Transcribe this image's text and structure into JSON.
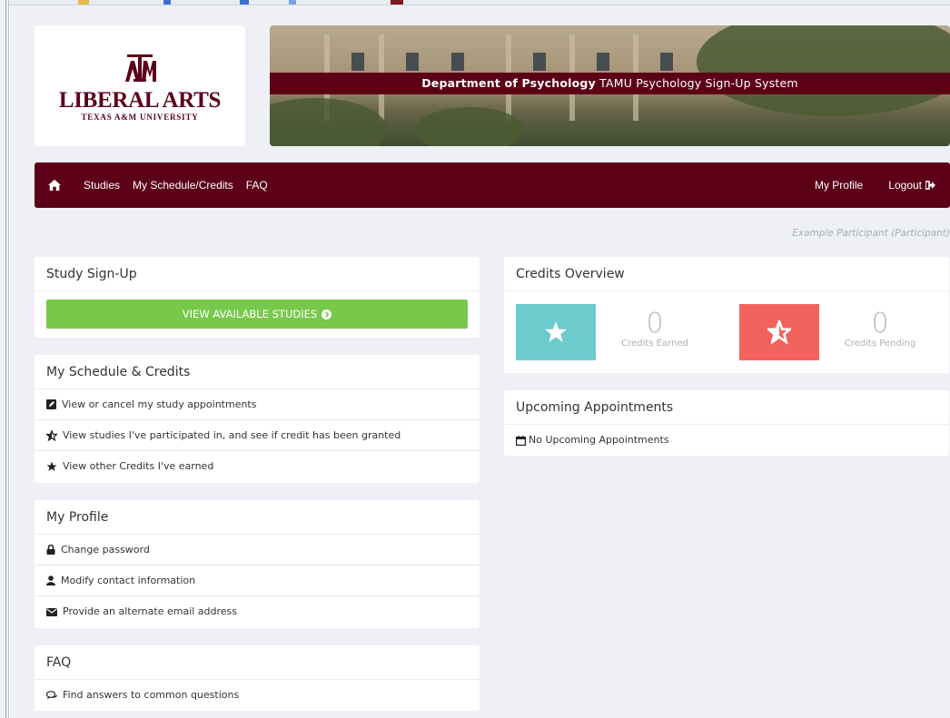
{
  "header": {
    "logo_text": "LIBERAL ARTS",
    "logo_sub": "TEXAS A&M UNIVERSITY",
    "banner_bold": "Department of Psychology",
    "banner_text": " TAMU Psychology Sign-Up System"
  },
  "nav": {
    "items": [
      "Studies",
      "My Schedule/Credits",
      "FAQ"
    ],
    "profile": "My Profile",
    "logout": "Logout"
  },
  "user": "Example Participant (Participant)",
  "study_signup": {
    "title": "Study Sign-Up",
    "button": "VIEW AVAILABLE STUDIES"
  },
  "schedule": {
    "title": "My Schedule & Credits",
    "items": [
      {
        "icon": "edit-icon",
        "label": "View or cancel my study appointments"
      },
      {
        "icon": "half-star-icon",
        "label": "View studies I've participated in, and see if credit has been granted"
      },
      {
        "icon": "star-icon",
        "label": "View other Credits I've earned"
      }
    ]
  },
  "profile": {
    "title": "My Profile",
    "items": [
      {
        "icon": "lock-icon",
        "label": "Change password"
      },
      {
        "icon": "user-icon",
        "label": "Modify contact information"
      },
      {
        "icon": "envelope-icon",
        "label": "Provide an alternate email address"
      }
    ]
  },
  "faq": {
    "title": "FAQ",
    "items": [
      {
        "icon": "comments-icon",
        "label": "Find answers to common questions"
      }
    ]
  },
  "credits": {
    "title": "Credits Overview",
    "earned_value": "0",
    "earned_label": "Credits Earned",
    "pending_value": "0",
    "pending_label": "Credits Pending"
  },
  "appointments": {
    "title": "Upcoming Appointments",
    "empty": "No Upcoming Appointments"
  },
  "colors": {
    "maroon": "#5c0018",
    "green": "#78c84c",
    "teal": "#6ccbcc",
    "coral": "#f2635e"
  }
}
